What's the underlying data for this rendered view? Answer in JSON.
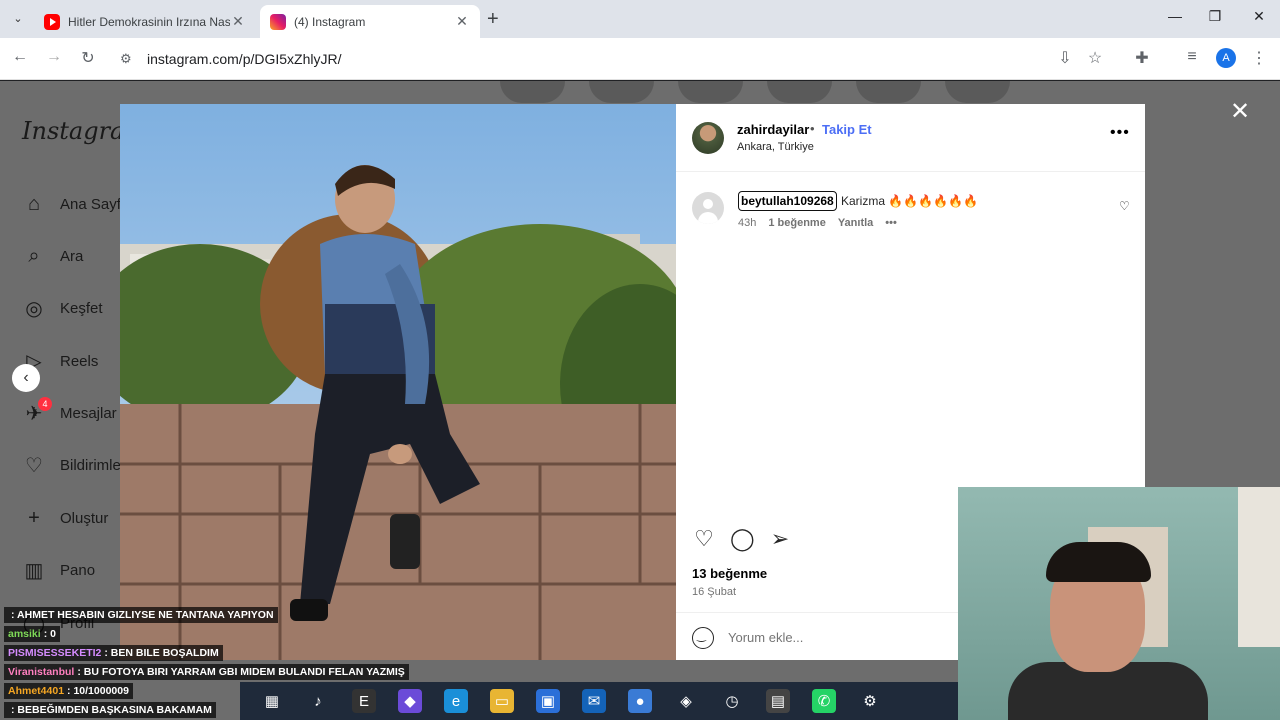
{
  "browser": {
    "tabs": [
      {
        "title": "Hitler Demokrasinin Irzına Nası",
        "active": false
      },
      {
        "title": "(4) Instagram",
        "active": true
      }
    ],
    "url": "instagram.com/p/DGI5xZhlyJR/",
    "profile_initial": "A"
  },
  "sidebar": {
    "logo": "Instagram",
    "items": [
      {
        "label": "Ana Sayfa",
        "icon": "home-icon"
      },
      {
        "label": "Ara",
        "icon": "search-icon"
      },
      {
        "label": "Keşfet",
        "icon": "compass-icon"
      },
      {
        "label": "Reels",
        "icon": "reels-icon"
      },
      {
        "label": "Mesajlar",
        "icon": "messages-icon"
      },
      {
        "label": "Bildirimler",
        "icon": "heart-icon"
      },
      {
        "label": "Oluştur",
        "icon": "plus-icon"
      },
      {
        "label": "Pano",
        "icon": "dashboard-icon"
      },
      {
        "label": "Profil",
        "icon": "profile-icon"
      }
    ],
    "messages_badge": "4"
  },
  "post": {
    "author": "zahirdayilar",
    "follow_label": "Takip Et",
    "location": "Ankara, Türkiye",
    "comments": [
      {
        "user": "beytullah109268",
        "text": "Karizma 🔥🔥🔥🔥🔥🔥",
        "time": "43h",
        "likes": "1 beğenme",
        "reply": "Yanıtla"
      }
    ],
    "likes": "13 beğenme",
    "date": "16 Şubat",
    "comment_placeholder": "Yorum ekle..."
  },
  "chat": [
    {
      "user": "",
      "message": "AHMET HESABIN GIZLIYSE NE TANTANA YAPIYON"
    },
    {
      "user": "amsiki",
      "message": "0"
    },
    {
      "user": "PISMISESSEKETI2",
      "message": "BEN BILE BOŞALDIM"
    },
    {
      "user": "Viranistanbul",
      "message": "BU FOTOYA BIRI YARRAM GBI MIDEM BULANDI FELAN YAZMIŞ"
    },
    {
      "user": "Ahmet4401",
      "message": "10/1000009"
    },
    {
      "user": "",
      "message": "BEBEĞIMDEN BAŞKASINA BAKAMAM"
    }
  ],
  "colors": {
    "follow": "#4c6ef5",
    "badge": "#ff3040",
    "chrome_tabbar": "#dfe3ea"
  }
}
